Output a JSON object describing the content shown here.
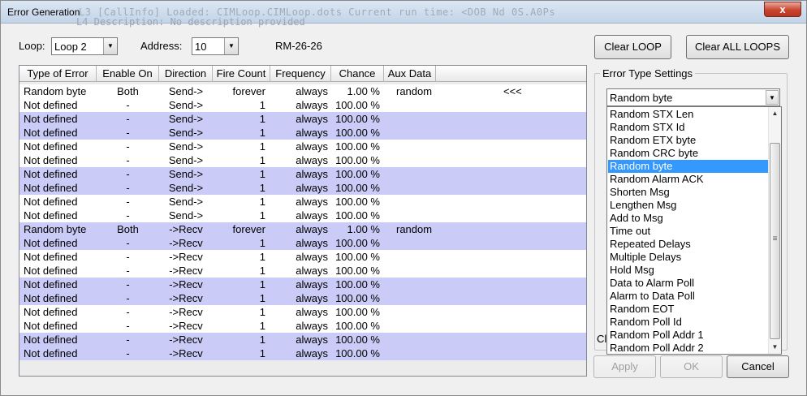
{
  "window": {
    "title": "Error Generation",
    "title_ghost": "L3  [CallInfo] Loaded:  CIMLoop.CIMLoop.dots   Current run time: <DOB Nd 0S.A0Ps",
    "title_ghost2": "L4  Description:  No description provided",
    "close_label": "x"
  },
  "top": {
    "loop_label": "Loop:",
    "loop_value": "Loop 2",
    "address_label": "Address:",
    "address_value": "10",
    "rm_label": "RM-26-26",
    "clear_loop": "Clear LOOP",
    "clear_all_loops": "Clear ALL LOOPS"
  },
  "table": {
    "headers": [
      "Type of Error",
      "Enable On",
      "Direction",
      "Fire Count",
      "Frequency",
      "Chance",
      "Aux Data"
    ],
    "marker": "<<<",
    "rows": [
      {
        "type": "Random byte",
        "enable": "Both",
        "dir": "Send->",
        "fire": "forever",
        "freq": "always",
        "chance": "1.00 %",
        "aux": "random",
        "marker": "<<<"
      },
      {
        "type": "Not defined",
        "enable": "-",
        "dir": "Send->",
        "fire": "1",
        "freq": "always",
        "chance": "100.00 %",
        "aux": "",
        "marker": ""
      },
      {
        "type": "Not defined",
        "enable": "-",
        "dir": "Send->",
        "fire": "1",
        "freq": "always",
        "chance": "100.00 %",
        "aux": "",
        "marker": ""
      },
      {
        "type": "Not defined",
        "enable": "-",
        "dir": "Send->",
        "fire": "1",
        "freq": "always",
        "chance": "100.00 %",
        "aux": "",
        "marker": ""
      },
      {
        "type": "Not defined",
        "enable": "-",
        "dir": "Send->",
        "fire": "1",
        "freq": "always",
        "chance": "100.00 %",
        "aux": "",
        "marker": ""
      },
      {
        "type": "Not defined",
        "enable": "-",
        "dir": "Send->",
        "fire": "1",
        "freq": "always",
        "chance": "100.00 %",
        "aux": "",
        "marker": ""
      },
      {
        "type": "Not defined",
        "enable": "-",
        "dir": "Send->",
        "fire": "1",
        "freq": "always",
        "chance": "100.00 %",
        "aux": "",
        "marker": ""
      },
      {
        "type": "Not defined",
        "enable": "-",
        "dir": "Send->",
        "fire": "1",
        "freq": "always",
        "chance": "100.00 %",
        "aux": "",
        "marker": ""
      },
      {
        "type": "Not defined",
        "enable": "-",
        "dir": "Send->",
        "fire": "1",
        "freq": "always",
        "chance": "100.00 %",
        "aux": "",
        "marker": ""
      },
      {
        "type": "Not defined",
        "enable": "-",
        "dir": "Send->",
        "fire": "1",
        "freq": "always",
        "chance": "100.00 %",
        "aux": "",
        "marker": ""
      },
      {
        "type": "Random byte",
        "enable": "Both",
        "dir": "->Recv",
        "fire": "forever",
        "freq": "always",
        "chance": "1.00 %",
        "aux": "random",
        "marker": ""
      },
      {
        "type": "Not defined",
        "enable": "-",
        "dir": "->Recv",
        "fire": "1",
        "freq": "always",
        "chance": "100.00 %",
        "aux": "",
        "marker": ""
      },
      {
        "type": "Not defined",
        "enable": "-",
        "dir": "->Recv",
        "fire": "1",
        "freq": "always",
        "chance": "100.00 %",
        "aux": "",
        "marker": ""
      },
      {
        "type": "Not defined",
        "enable": "-",
        "dir": "->Recv",
        "fire": "1",
        "freq": "always",
        "chance": "100.00 %",
        "aux": "",
        "marker": ""
      },
      {
        "type": "Not defined",
        "enable": "-",
        "dir": "->Recv",
        "fire": "1",
        "freq": "always",
        "chance": "100.00 %",
        "aux": "",
        "marker": ""
      },
      {
        "type": "Not defined",
        "enable": "-",
        "dir": "->Recv",
        "fire": "1",
        "freq": "always",
        "chance": "100.00 %",
        "aux": "",
        "marker": ""
      },
      {
        "type": "Not defined",
        "enable": "-",
        "dir": "->Recv",
        "fire": "1",
        "freq": "always",
        "chance": "100.00 %",
        "aux": "",
        "marker": ""
      },
      {
        "type": "Not defined",
        "enable": "-",
        "dir": "->Recv",
        "fire": "1",
        "freq": "always",
        "chance": "100.00 %",
        "aux": "",
        "marker": ""
      },
      {
        "type": "Not defined",
        "enable": "-",
        "dir": "->Recv",
        "fire": "1",
        "freq": "always",
        "chance": "100.00 %",
        "aux": "",
        "marker": ""
      },
      {
        "type": "Not defined",
        "enable": "-",
        "dir": "->Recv",
        "fire": "1",
        "freq": "always",
        "chance": "100.00 %",
        "aux": "",
        "marker": ""
      }
    ]
  },
  "settings": {
    "legend": "Error Type Settings",
    "selected": "Random byte",
    "partial_label": "Cl",
    "options": [
      "Random STX Len",
      "Random STX Id",
      "Random ETX byte",
      "Random CRC byte",
      "Random byte",
      "Random Alarm ACK",
      "Shorten Msg",
      "Lengthen Msg",
      "Add to Msg",
      "Time out",
      "Repeated Delays",
      "Multiple Delays",
      "Hold Msg",
      "Data to Alarm Poll",
      "Alarm to Data Poll",
      "Random EOT",
      "Random Poll Id",
      "Random Poll Addr 1",
      "Random Poll Addr 2"
    ],
    "selected_index": 4
  },
  "buttons": {
    "apply": "Apply",
    "ok": "OK",
    "cancel": "Cancel"
  },
  "colors": {
    "alt_row": "#cbcbf7",
    "selection": "#3399ff"
  }
}
